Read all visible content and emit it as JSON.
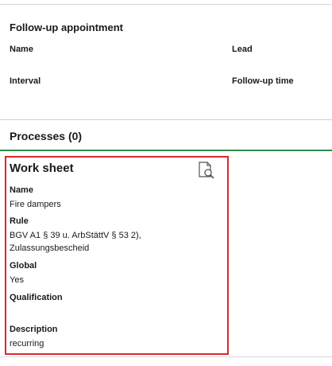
{
  "followup": {
    "title": "Follow-up appointment",
    "name_label": "Name",
    "lead_label": "Lead",
    "interval_label": "Interval",
    "followup_time_label": "Follow-up time"
  },
  "processes": {
    "title": "Processes (0)"
  },
  "worksheet": {
    "title": "Work sheet",
    "icon": "document-search-icon",
    "fields": {
      "name_label": "Name",
      "name_value": "Fire dampers",
      "rule_label": "Rule",
      "rule_value_line1": "BGV A1 § 39 u. ArbStättV § 53 2),",
      "rule_value_line2": "Zulassungsbescheid",
      "global_label": "Global",
      "global_value": "Yes",
      "qualification_label": "Qualification",
      "qualification_value": "",
      "description_label": "Description",
      "description_value": "recurring"
    }
  },
  "colors": {
    "highlight_border": "#d9282d",
    "section_underline": "#2e8b4a",
    "divider": "#d0d0d0"
  }
}
